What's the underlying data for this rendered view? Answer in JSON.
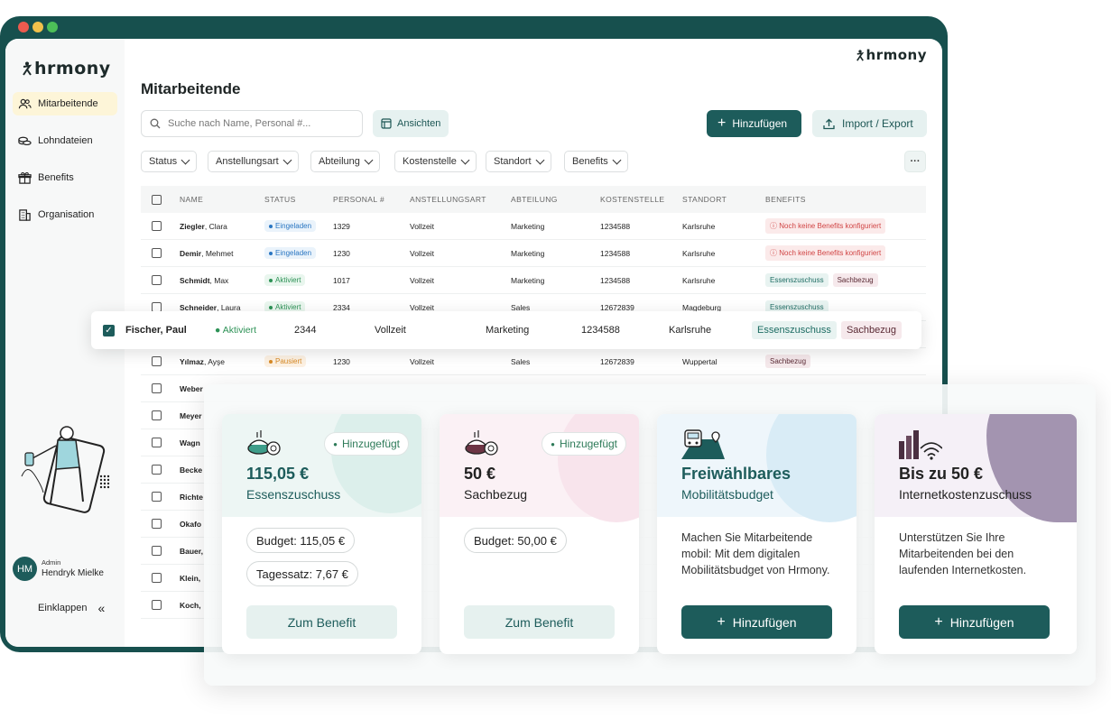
{
  "app": {
    "logo": "hrmony"
  },
  "sidebar": {
    "items": [
      {
        "label": "Mitarbeitende"
      },
      {
        "label": "Lohndateien"
      },
      {
        "label": "Benefits"
      },
      {
        "label": "Organisation"
      }
    ],
    "user": {
      "initials": "HM",
      "role": "Admin",
      "name": "Hendryk Mielke"
    },
    "collapse_label": "Einklappen"
  },
  "page": {
    "title": "Mitarbeitende"
  },
  "toolbar": {
    "search_placeholder": "Suche nach Name, Personal #...",
    "views_label": "Ansichten",
    "add_label": "Hinzufügen",
    "import_label": "Import / Export"
  },
  "filters": [
    "Status",
    "Anstellungsart",
    "Abteilung",
    "Kostenstelle",
    "Standort",
    "Benefits"
  ],
  "table": {
    "headers": [
      "NAME",
      "STATUS",
      "PERSONAL #",
      "ANSTELLUNGSART",
      "ABTEILUNG",
      "KOSTENSTELLE",
      "STANDORT",
      "BENEFITS"
    ],
    "rows": [
      {
        "last": "Ziegler",
        "first": ", Clara",
        "status": "Eingeladen",
        "pers": "1329",
        "anst": "Vollzeit",
        "abt": "Marketing",
        "kost": "1234588",
        "stand": "Karlsruhe",
        "benefit": "Noch keine Benefits konfiguriert"
      },
      {
        "last": "Demir",
        "first": ", Mehmet",
        "status": "Eingeladen",
        "pers": "1230",
        "anst": "Vollzeit",
        "abt": "Marketing",
        "kost": "1234588",
        "stand": "Karlsruhe",
        "benefit": "Noch keine Benefits konfiguriert"
      },
      {
        "last": "Schmidt",
        "first": ", Max",
        "status": "Aktiviert",
        "pers": "1017",
        "anst": "Vollzeit",
        "abt": "Marketing",
        "kost": "1234588",
        "stand": "Karlsruhe",
        "benefit": "Essenszuschuss",
        "benefit2": "Sachbezug"
      },
      {
        "last": "Schneider",
        "first": ", Laura",
        "status": "Aktiviert",
        "pers": "2334",
        "anst": "Vollzeit",
        "abt": "Sales",
        "kost": "12672839",
        "stand": "Magdeburg",
        "benefit": "Essenszuschuss"
      },
      {
        "last": "",
        "first": "",
        "status": "",
        "pers": "",
        "anst": "",
        "abt": "",
        "kost": "",
        "stand": "",
        "benefit": ""
      },
      {
        "last": "Yılmaz",
        "first": ", Ayşe",
        "status": "Pausiert",
        "pers": "1230",
        "anst": "Vollzeit",
        "abt": "Sales",
        "kost": "12672839",
        "stand": "Wuppertal",
        "benefit": "Sachbezug"
      },
      {
        "last": "Weber",
        "first": ""
      },
      {
        "last": "Meyer",
        "first": ""
      },
      {
        "last": "Wagn",
        "first": ""
      },
      {
        "last": "Becke",
        "first": ""
      },
      {
        "last": "Richte",
        "first": ""
      },
      {
        "last": "Okafo",
        "first": ""
      },
      {
        "last": "Bauer,",
        "first": ""
      },
      {
        "last": "Klein,",
        "first": ""
      },
      {
        "last": "Koch,",
        "first": ""
      }
    ]
  },
  "selected_row": {
    "name": "Fischer, Paul",
    "status": "Aktiviert",
    "pers": "2344",
    "anst": "Vollzeit",
    "abt": "Marketing",
    "kost": "1234588",
    "stand": "Karlsruhe",
    "b1": "Essenszuschuss",
    "b2": "Sachbezug"
  },
  "cards": [
    {
      "amount": "115,05 €",
      "name": "Essenszuschuss",
      "badge": "Hinzugefügt",
      "pill1": "Budget: 115,05 €",
      "pill2": "Tagessatz: 7,67 €",
      "button": "Zum Benefit",
      "accent": "#dcefeb"
    },
    {
      "amount": "50 €",
      "name": "Sachbezug",
      "badge": "Hinzugefügt",
      "pill1": "Budget: 50,00 €",
      "button": "Zum Benefit",
      "accent": "#f8e4ec"
    },
    {
      "amount": "Freiwählbares",
      "name": "Mobilitätsbudget",
      "desc": "Machen Sie Mitarbeitende mobil: Mit dem digitalen Mobilitätsbudget von Hrmony.",
      "button": "Hinzufügen",
      "accent": "#d9ecf6"
    },
    {
      "amount": "Bis zu 50 €",
      "name": "Internetkostenzuschuss",
      "desc": "Unterstützen Sie Ihre Mitarbeitenden bei den laufenden Internetkosten.",
      "button": "Hinzufügen",
      "accent": "#a394b0"
    }
  ],
  "colors": {
    "brand": "#1d5c5b",
    "frame": "#17504e"
  }
}
